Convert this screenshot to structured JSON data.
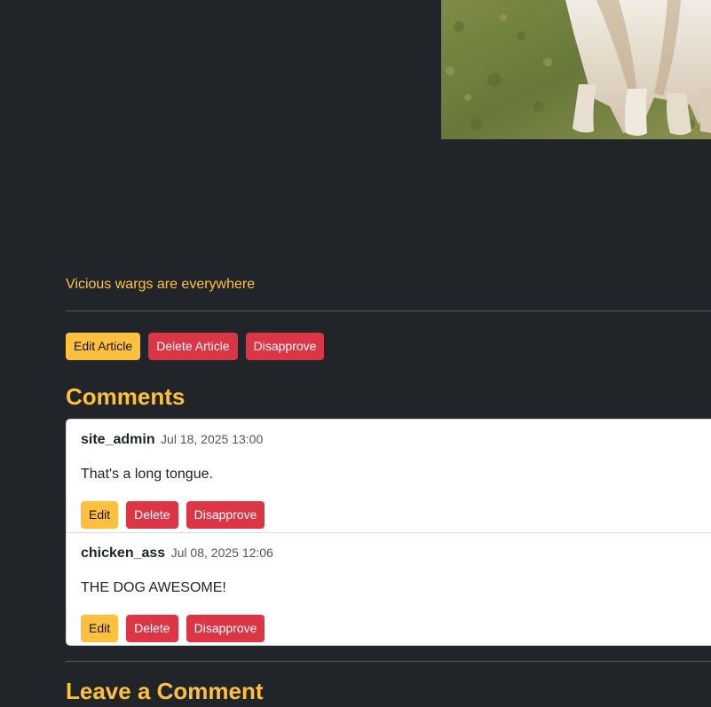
{
  "article": {
    "photo_alt": "dog-photo",
    "caption": "Vicious wargs are everywhere",
    "actions": {
      "edit_label": "Edit Article",
      "delete_label": "Delete Article",
      "disapprove_label": "Disapprove"
    }
  },
  "comments_section": {
    "title": "Comments",
    "items": [
      {
        "author": "site_admin",
        "date": "Jul 18, 2025 13:00",
        "body": "That's a long tongue.",
        "edit_label": "Edit",
        "delete_label": "Delete",
        "disapprove_label": "Disapprove"
      },
      {
        "author": "chicken_ass",
        "date": "Jul 08, 2025 12:06",
        "body": "THE DOG AWESOME!",
        "edit_label": "Edit",
        "delete_label": "Delete",
        "disapprove_label": "Disapprove"
      }
    ]
  },
  "leave_comment": {
    "title": "Leave a Comment"
  },
  "colors": {
    "background": "#212529",
    "accent": "#ffc13d",
    "danger": "#dc3545"
  }
}
